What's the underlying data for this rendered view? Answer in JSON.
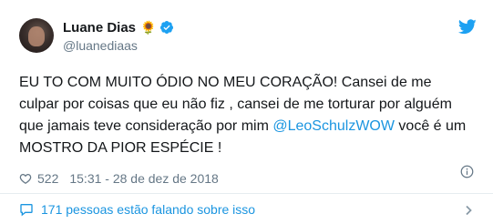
{
  "user": {
    "display_name": "Luane Dias",
    "emoji": "🌻",
    "handle": "@luanediaas"
  },
  "tweet": {
    "text_before": "EU TO COM MUITO ÓDIO NO MEU CORAÇÃO! Cansei de me culpar por coisas que eu não fiz , cansei de me torturar por alguém que jamais teve consideração por mim ",
    "mention": "@LeoSchulzWOW",
    "text_after": " você é um MOSTRO DA PIOR ESPÉCIE !"
  },
  "meta": {
    "likes": "522",
    "time": "15:31 - 28 de dez de 2018"
  },
  "conversation_label": "171 pessoas estão falando sobre isso",
  "colors": {
    "accent": "#1b95e0",
    "muted": "#657786",
    "text": "#14171a",
    "verified": "#1da1f2",
    "divider": "#e6ecf0"
  },
  "icons": {
    "twitter": "twitter-bird-icon",
    "verified": "verified-badge-icon",
    "like": "heart-icon",
    "info": "info-icon",
    "conversation": "chat-bubble-icon",
    "expand": "chevron-right-icon"
  }
}
